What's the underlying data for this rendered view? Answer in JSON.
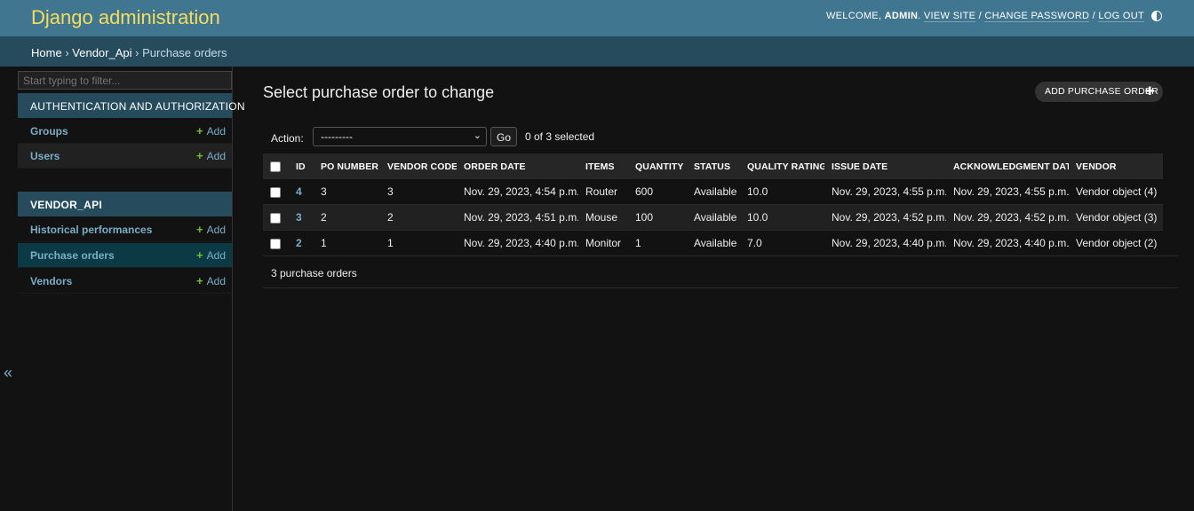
{
  "header": {
    "brand": "Django administration",
    "welcome": "WELCOME,",
    "username": "ADMIN",
    "view_site": "VIEW SITE",
    "change_password": "CHANGE PASSWORD",
    "log_out": "LOG OUT",
    "separator": "/"
  },
  "breadcrumbs": {
    "home": "Home",
    "app": "Vendor_Api",
    "current": "Purchase orders",
    "separator": "›"
  },
  "nav": {
    "filter_placeholder": "Start typing to filter...",
    "toggle": "«",
    "modules": [
      {
        "caption": "AUTHENTICATION AND AUTHORIZATION",
        "models": [
          {
            "name": "Groups",
            "add": "Add"
          },
          {
            "name": "Users",
            "add": "Add"
          }
        ]
      },
      {
        "caption": "VENDOR_API",
        "models": [
          {
            "name": "Historical performances",
            "add": "Add"
          },
          {
            "name": "Purchase orders",
            "add": "Add"
          },
          {
            "name": "Vendors",
            "add": "Add"
          }
        ]
      }
    ]
  },
  "content": {
    "title": "Select purchase order to change",
    "add_button": "ADD PURCHASE ORDER",
    "action_label": "Action:",
    "action_selected": "---------",
    "go": "Go",
    "selection_count": "0 of 3 selected",
    "columns": [
      "ID",
      "PO NUMBER",
      "VENDOR CODE",
      "ORDER DATE",
      "ITEMS",
      "QUANTITY",
      "STATUS",
      "QUALITY RATING",
      "ISSUE DATE",
      "ACKNOWLEDGMENT DATE",
      "VENDOR"
    ],
    "rows": [
      [
        "4",
        "3",
        "3",
        "Nov. 29, 2023, 4:54 p.m.",
        "Router",
        "600",
        "Available",
        "10.0",
        "Nov. 29, 2023, 4:55 p.m.",
        "Nov. 29, 2023, 4:55 p.m.",
        "Vendor object (4)"
      ],
      [
        "3",
        "2",
        "2",
        "Nov. 29, 2023, 4:51 p.m.",
        "Mouse",
        "100",
        "Available",
        "10.0",
        "Nov. 29, 2023, 4:52 p.m.",
        "Nov. 29, 2023, 4:52 p.m.",
        "Vendor object (3)"
      ],
      [
        "2",
        "1",
        "1",
        "Nov. 29, 2023, 4:40 p.m.",
        "Monitor",
        "1",
        "Available",
        "7.0",
        "Nov. 29, 2023, 4:40 p.m.",
        "Nov. 29, 2023, 4:40 p.m.",
        "Vendor object (2)"
      ]
    ],
    "paginator": "3 purchase orders"
  },
  "colors": {
    "header_bg": "#417690",
    "brand": "#f5dd5d",
    "breadcrumb_bg": "#264b5d",
    "link": "#79aec8",
    "add_plus": "#70bf2b",
    "page_bg": "#121212"
  }
}
